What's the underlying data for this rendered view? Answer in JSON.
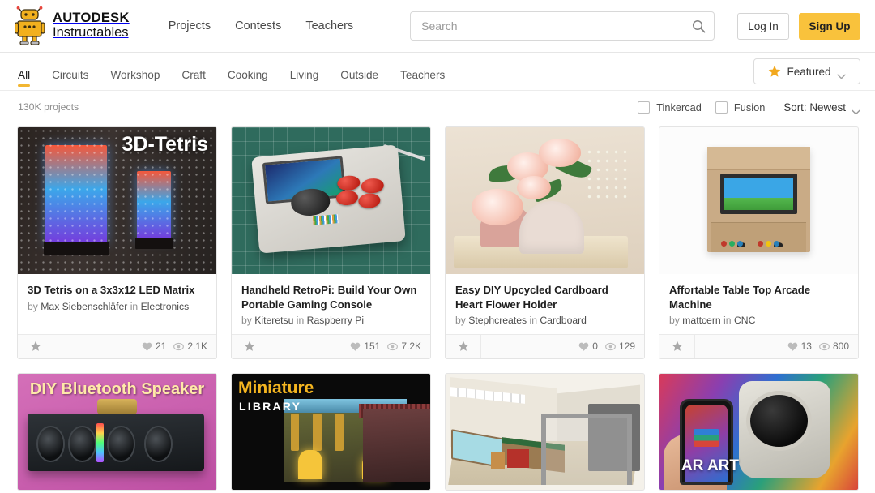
{
  "header": {
    "brand": {
      "line1": "AUTODESK",
      "line2": "Instructables",
      "logo_icon": "instructables-robot-icon"
    },
    "nav": [
      {
        "label": "Projects"
      },
      {
        "label": "Contests"
      },
      {
        "label": "Teachers"
      }
    ],
    "search": {
      "placeholder": "Search",
      "value": "",
      "icon": "search-icon"
    },
    "login_label": "Log In",
    "signup_label": "Sign Up",
    "signup_color": "#f9c23c"
  },
  "categories": {
    "items": [
      {
        "label": "All",
        "active": true
      },
      {
        "label": "Circuits",
        "active": false
      },
      {
        "label": "Workshop",
        "active": false
      },
      {
        "label": "Craft",
        "active": false
      },
      {
        "label": "Cooking",
        "active": false
      },
      {
        "label": "Living",
        "active": false
      },
      {
        "label": "Outside",
        "active": false
      },
      {
        "label": "Teachers",
        "active": false
      }
    ],
    "active_underline_color": "#f2b632",
    "featured": {
      "label": "Featured",
      "icon": "star-icon",
      "chevron": "chevron-down-icon"
    }
  },
  "filters": {
    "project_count": "130K projects",
    "checkboxes": [
      {
        "label": "Tinkercad",
        "checked": false
      },
      {
        "label": "Fusion",
        "checked": false
      }
    ],
    "sort": {
      "label": "Sort: Newest",
      "chevron": "chevron-down-icon"
    }
  },
  "cards": [
    {
      "title": "3D Tetris on a 3x3x12 LED Matrix",
      "by_prefix": "by",
      "author": "Max Siebenschläfer",
      "in_prefix": "in",
      "channel": "Electronics",
      "likes": "21",
      "views": "2.1K",
      "thumb_overlay": "3D-Tetris"
    },
    {
      "title": "Handheld RetroPi: Build Your Own Portable Gaming Console",
      "by_prefix": "by",
      "author": "Kiteretsu",
      "in_prefix": "in",
      "channel": "Raspberry Pi",
      "likes": "151",
      "views": "7.2K",
      "thumb_overlay": ""
    },
    {
      "title": "Easy DIY Upcycled Cardboard Heart Flower Holder",
      "by_prefix": "by",
      "author": "Stephcreates",
      "in_prefix": "in",
      "channel": "Cardboard",
      "likes": "0",
      "views": "129",
      "thumb_overlay": ""
    },
    {
      "title": "Affortable Table Top Arcade Machine",
      "by_prefix": "by",
      "author": "mattcern",
      "in_prefix": "in",
      "channel": "CNC",
      "likes": "13",
      "views": "800",
      "thumb_overlay": ""
    }
  ],
  "cards_row2": [
    {
      "thumb_overlay": "DIY Bluetooth Speaker"
    },
    {
      "thumb_overlay_1": "Miniature",
      "thumb_overlay_2": "LIBRARY"
    },
    {
      "thumb_overlay": ""
    },
    {
      "thumb_overlay": "AR ART"
    }
  ]
}
